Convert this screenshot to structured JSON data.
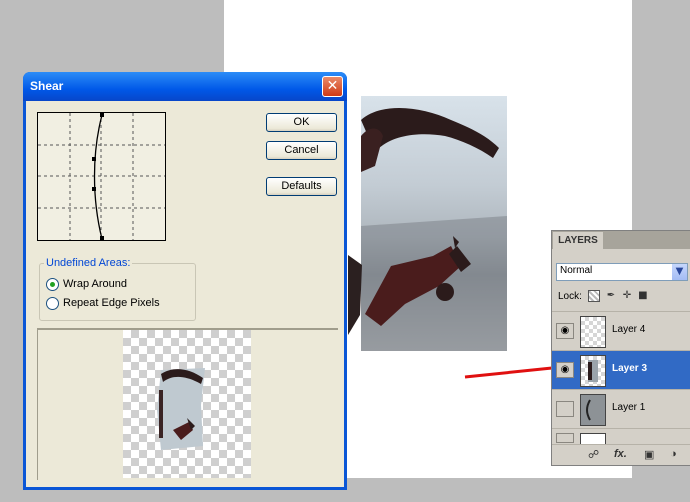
{
  "dialog": {
    "title": "Shear",
    "close_glyph": "✕",
    "buttons": {
      "ok": "OK",
      "cancel": "Cancel",
      "defaults": "Defaults"
    },
    "undefined_areas": {
      "legend": "Undefined Areas:",
      "options": [
        {
          "label": "Wrap Around",
          "selected": true
        },
        {
          "label": "Repeat Edge Pixels",
          "selected": false
        }
      ]
    }
  },
  "layers_panel": {
    "tab": "LAYERS",
    "blend_mode": "Normal",
    "lock_label": "Lock:",
    "layers": [
      {
        "name": "Layer 4",
        "visible": true,
        "selected": false
      },
      {
        "name": "Layer 3",
        "visible": true,
        "selected": true
      },
      {
        "name": "Layer 1",
        "visible": false,
        "selected": false
      }
    ],
    "footer_fx": "fx."
  },
  "icons": {
    "eye": "eye-icon",
    "dropdown": "chevron-down-icon",
    "link": "link-icon",
    "fx": "fx-icon",
    "mask": "mask-icon",
    "adjust": "adjustment-icon",
    "lock_transparent": "lock-transparent-icon",
    "lock_brush": "lock-brush-icon",
    "lock_move": "lock-move-icon",
    "lock_all": "lock-all-icon"
  },
  "colors": {
    "title_bar": "#0058e8",
    "dialog_face": "#ece9d8",
    "selected_layer": "#316ac5",
    "annotation": "#e01010"
  }
}
